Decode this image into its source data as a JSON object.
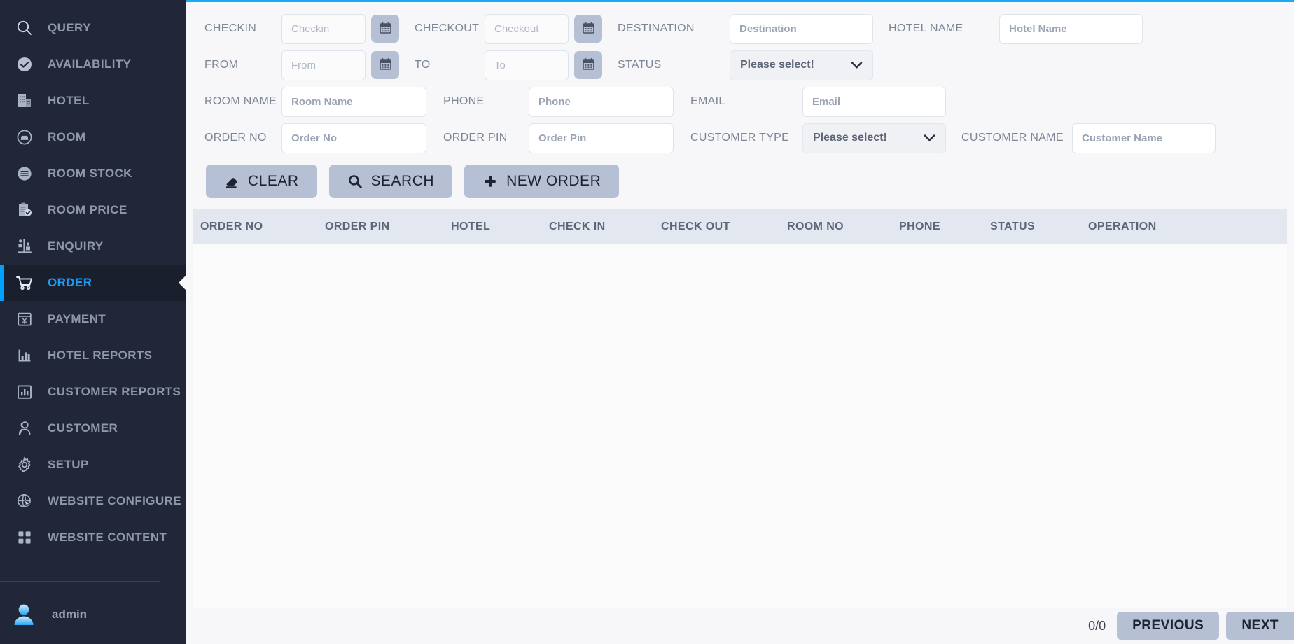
{
  "sidebar": {
    "items": [
      {
        "label": "QUERY",
        "icon": "search-icon",
        "active": false
      },
      {
        "label": "AVAILABILITY",
        "icon": "check-circle-icon",
        "active": false
      },
      {
        "label": "HOTEL",
        "icon": "building-icon",
        "active": false
      },
      {
        "label": "ROOM",
        "icon": "bed-circle-icon",
        "active": false
      },
      {
        "label": "ROOM STOCK",
        "icon": "stock-circle-icon",
        "active": false
      },
      {
        "label": "ROOM PRICE",
        "icon": "clipboard-check-icon",
        "active": false
      },
      {
        "label": "ENQUIRY",
        "icon": "enquiry-icon",
        "active": false
      },
      {
        "label": "ORDER",
        "icon": "cart-icon",
        "active": true
      },
      {
        "label": "PAYMENT",
        "icon": "payment-yen-icon",
        "active": false
      },
      {
        "label": "HOTEL REPORTS",
        "icon": "bar-chart-icon",
        "active": false
      },
      {
        "label": "CUSTOMER REPORTS",
        "icon": "chart-box-icon",
        "active": false
      },
      {
        "label": "CUSTOMER",
        "icon": "users-icon",
        "active": false
      },
      {
        "label": "SETUP",
        "icon": "gear-icon",
        "active": false
      },
      {
        "label": "WEBSITE CONFIGURE",
        "icon": "globe-cursor-icon",
        "active": false
      },
      {
        "label": "WEBSITE CONTENT",
        "icon": "grid-squares-icon",
        "active": false
      }
    ],
    "user": {
      "name": "admin",
      "avatar_icon": "avatar-icon"
    }
  },
  "filters": {
    "checkin": {
      "label": "CHECKIN",
      "placeholder": "Checkin",
      "value": "",
      "calendar_icon": "calendar-icon"
    },
    "checkout": {
      "label": "CHECKOUT",
      "placeholder": "Checkout",
      "value": "",
      "calendar_icon": "calendar-icon"
    },
    "destination": {
      "label": "DESTINATION",
      "placeholder": "Destination",
      "value": ""
    },
    "hotel_name": {
      "label": "HOTEL NAME",
      "placeholder": "Hotel Name",
      "value": ""
    },
    "from": {
      "label": "FROM",
      "placeholder": "From",
      "value": "",
      "calendar_icon": "calendar-icon"
    },
    "to": {
      "label": "TO",
      "placeholder": "To",
      "value": "",
      "calendar_icon": "calendar-icon"
    },
    "status": {
      "label": "STATUS",
      "selected": "Please select!"
    },
    "room_name": {
      "label": "ROOM NAME",
      "placeholder": "Room Name",
      "value": ""
    },
    "phone": {
      "label": "PHONE",
      "placeholder": "Phone",
      "value": ""
    },
    "email": {
      "label": "EMAIL",
      "placeholder": "Email",
      "value": ""
    },
    "order_no": {
      "label": "ORDER NO",
      "placeholder": "Order No",
      "value": ""
    },
    "order_pin": {
      "label": "ORDER PIN",
      "placeholder": "Order Pin",
      "value": ""
    },
    "customer_type": {
      "label": "CUSTOMER TYPE",
      "selected": "Please select!"
    },
    "customer_name": {
      "label": "CUSTOMER NAME",
      "placeholder": "Customer Name",
      "value": ""
    }
  },
  "actions": {
    "clear": {
      "label": "CLEAR",
      "icon": "eraser-icon"
    },
    "search": {
      "label": "SEARCH",
      "icon": "search-icon"
    },
    "new_order": {
      "label": "NEW ORDER",
      "icon": "plus-icon"
    }
  },
  "table": {
    "columns": [
      "ORDER NO",
      "ORDER PIN",
      "HOTEL",
      "CHECK IN",
      "CHECK OUT",
      "ROOM NO",
      "PHONE",
      "STATUS",
      "OPERATION"
    ],
    "rows": []
  },
  "pagination": {
    "count": "0/0",
    "previous_label": "PREVIOUS",
    "next_label": "NEXT"
  },
  "colors": {
    "sidebar_bg": "#212738",
    "sidebar_active_bg": "#1a1f2e",
    "accent_blue": "#00a0ff",
    "top_border": "#1ba9f5",
    "button_bg": "#b6c0d4",
    "table_header_bg": "#e3e7f0",
    "content_bg": "#f7f7f9"
  }
}
